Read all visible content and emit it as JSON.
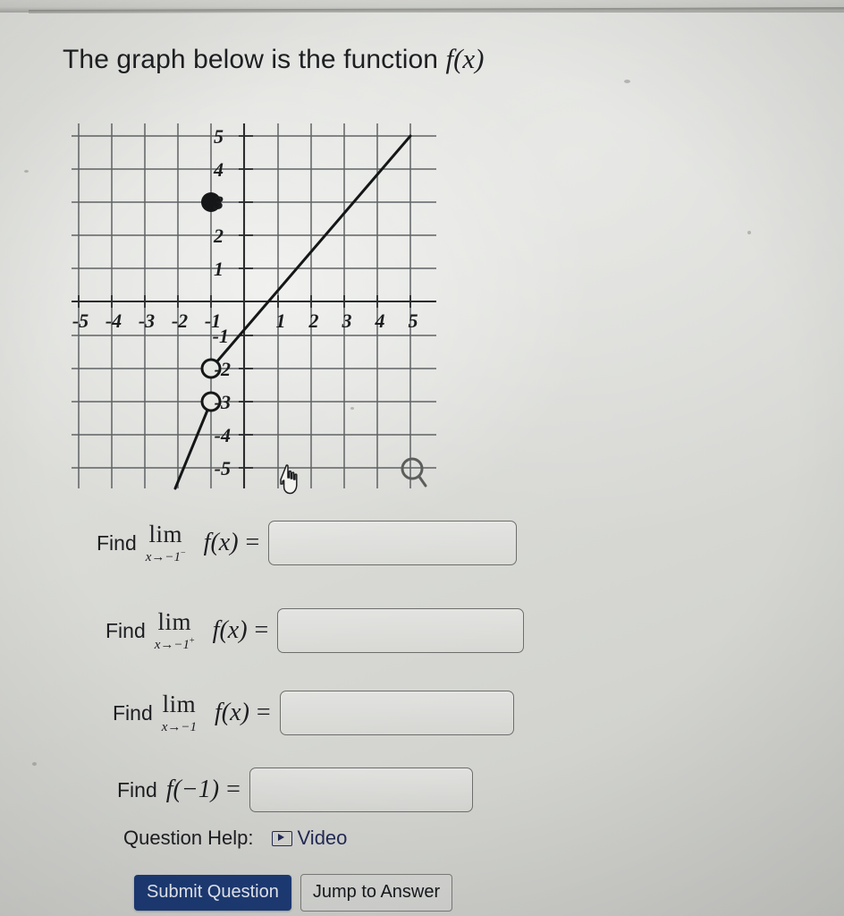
{
  "heading": {
    "text_before": "The graph below is the function ",
    "function_symbol": "f(x)"
  },
  "graph": {
    "x_tick_labels": [
      "-5",
      "-4",
      "-3",
      "-2",
      "-1",
      "1",
      "2",
      "3",
      "4",
      "5"
    ],
    "y_tick_labels": [
      "5",
      "4",
      "3",
      "2",
      "1",
      "-1",
      "-2",
      "-3",
      "-4",
      "-5"
    ],
    "cursor_icon": "pointing-hand-cursor",
    "zoom_icon": "magnifier-icon"
  },
  "chart_data": {
    "type": "line",
    "title": "",
    "xlabel": "",
    "ylabel": "",
    "xlim": [
      -5.5,
      5.5
    ],
    "ylim": [
      -5.5,
      5.5
    ],
    "grid": true,
    "xticks": [
      -5,
      -4,
      -3,
      -2,
      -1,
      1,
      2,
      3,
      4,
      5
    ],
    "yticks": [
      5,
      4,
      3,
      2,
      1,
      -1,
      -2,
      -3,
      -4,
      -5
    ],
    "legend": "none",
    "series": [
      {
        "name": "left-branch",
        "comment": "line segment approaching x = -1 from the left, ending at open circle (-1, -3)",
        "x": [
          -2.6,
          -1
        ],
        "y": [
          -5.4,
          -3
        ]
      },
      {
        "name": "right-branch",
        "comment": "line segment from open circle (-1, -2) rising to (5, 5)",
        "x": [
          -1,
          5
        ],
        "y": [
          -2,
          5
        ]
      }
    ],
    "points": [
      {
        "x": -1,
        "y": 3,
        "style": "filled",
        "label": "f(-1) = 3"
      },
      {
        "x": -1,
        "y": -2,
        "style": "open",
        "label": "right-hand limit = -2"
      },
      {
        "x": -1,
        "y": -3,
        "style": "open",
        "label": "left-hand limit = -3"
      }
    ]
  },
  "questions": [
    {
      "label": "Find",
      "limit_op": "lim",
      "limit_sub": "x→−1",
      "limit_side": "−",
      "function": "f(x)",
      "equals": "=",
      "value": "",
      "placeholder": ""
    },
    {
      "label": "Find",
      "limit_op": "lim",
      "limit_sub": "x→−1",
      "limit_side": "+",
      "function": "f(x)",
      "equals": "=",
      "value": "",
      "placeholder": ""
    },
    {
      "label": "Find",
      "limit_op": "lim",
      "limit_sub": "x→−1",
      "limit_side": "",
      "function": "f(x)",
      "equals": "=",
      "value": "",
      "placeholder": ""
    }
  ],
  "value_question": {
    "label": "Find",
    "expression": "f(−1)",
    "equals": "=",
    "value": "",
    "placeholder": ""
  },
  "help": {
    "label": "Question Help:",
    "video_label": "Video",
    "video_icon": "play-video-icon"
  },
  "buttons": {
    "submit_label": "Submit Question",
    "jump_label": "Jump to Answer"
  },
  "colors": {
    "submit_background": "#1d3b75",
    "link": "#232a55",
    "page_background": "#dcddd9"
  }
}
